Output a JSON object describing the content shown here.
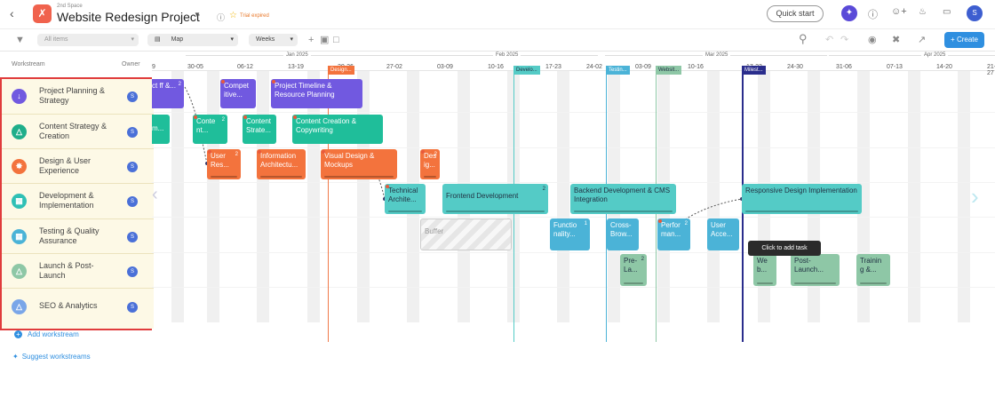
{
  "header": {
    "space": "2nd Space",
    "title": "Website Redesign Project",
    "trial": "Trial expired",
    "quick_start": "Quick start",
    "avatar": "S"
  },
  "toolbar": {
    "filter": "All items",
    "view": "Map",
    "scale": "Weeks",
    "create": "+ Create"
  },
  "sidebar": {
    "col_workstream": "Workstream",
    "col_owner": "Owner",
    "add": "Add workstream",
    "suggest": "Suggest workstreams",
    "items": [
      {
        "label": "Project Planning & Strategy",
        "color": "#7159e0",
        "icon": "branch-icon",
        "owner": "S"
      },
      {
        "label": "Content Strategy & Creation",
        "color": "#1fae8a",
        "icon": "flask-icon",
        "owner": "S"
      },
      {
        "label": "Design & User Experience",
        "color": "#f3733d",
        "icon": "palette-icon",
        "owner": "S"
      },
      {
        "label": "Development & Implementation",
        "color": "#2fc0b5",
        "icon": "grid-icon",
        "owner": "S"
      },
      {
        "label": "Testing & Quality Assurance",
        "color": "#4bb3d7",
        "icon": "grid-icon",
        "owner": "S"
      },
      {
        "label": "Launch & Post-Launch",
        "color": "#8ec7a6",
        "icon": "flask-icon",
        "owner": "S"
      },
      {
        "label": "SEO & Analytics",
        "color": "#7aa6e8",
        "icon": "flask-icon",
        "owner": "S"
      }
    ]
  },
  "timeline": {
    "months": [
      "Jan 2025",
      "Feb 2025",
      "Mar 2025",
      "Apr 2025"
    ],
    "weeks": [
      "9",
      "30-05",
      "06-12",
      "13-19",
      "20-26",
      "27-02",
      "03-09",
      "10-16",
      "17-23",
      "24-02",
      "03-09",
      "10-16",
      "17-23",
      "24-30",
      "31-06",
      "07-13",
      "14-20",
      "21-27"
    ],
    "milestones": [
      "Design...",
      "Develo...",
      "Testin...",
      "Websit...",
      "Milest..."
    ]
  },
  "tasks": [
    {
      "label": "ct ff &...",
      "count": "2"
    },
    {
      "label": "Compet itive...",
      "count": ""
    },
    {
      "label": "Project Timeline & Resource Planning",
      "count": ""
    },
    {
      "label": "m...",
      "count": ""
    },
    {
      "label": "Conte nt...",
      "count": "2"
    },
    {
      "label": "Content Strate...",
      "count": ""
    },
    {
      "label": "Content Creation & Copywriting",
      "count": ""
    },
    {
      "label": "User Res...",
      "count": "2"
    },
    {
      "label": "Information Architectu...",
      "count": ""
    },
    {
      "label": "Visual Design & Mockups",
      "count": ""
    },
    {
      "label": "Des ig...",
      "count": "2"
    },
    {
      "label": "Technical Archite...",
      "count": ""
    },
    {
      "label": "Frontend Development",
      "count": "2"
    },
    {
      "label": "Backend Development & CMS Integration",
      "count": ""
    },
    {
      "label": "Responsive Design Implementation",
      "count": ""
    },
    {
      "label": "Buffer",
      "count": ""
    },
    {
      "label": "Functio nality...",
      "count": "1"
    },
    {
      "label": "Cross- Brow...",
      "count": ""
    },
    {
      "label": "Perfor man...",
      "count": "2"
    },
    {
      "label": "User Acce...",
      "count": ""
    },
    {
      "label": "Pre- La...",
      "count": "2"
    },
    {
      "label": "We b...",
      "count": ""
    },
    {
      "label": "Post- Launch...",
      "count": ""
    },
    {
      "label": "Trainin g &...",
      "count": ""
    }
  ],
  "tooltip": "Click to add task"
}
